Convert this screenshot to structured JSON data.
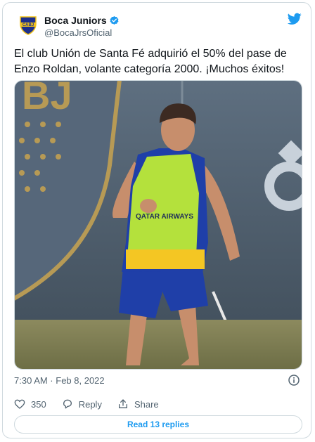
{
  "author": {
    "display_name": "Boca Juniors",
    "handle": "@BocaJrsOficial",
    "avatar_text": "CABJ",
    "verified_icon": "verified-badge-icon"
  },
  "tweet": {
    "text": "El club Unión de Santa Fé adquirió el 50% del pase de Enzo Roldan, volante categoría 2000. ¡Muchos éxitos!",
    "timestamp": "7:30 AM · Feb 8, 2022",
    "media": {
      "description_icon": "photo",
      "kit_text": "QATAR AIRWAYS"
    }
  },
  "actions": {
    "like_count": "350",
    "reply_label": "Reply",
    "share_label": "Share",
    "read_replies_label": "Read 13 replies"
  },
  "colors": {
    "accent": "#1d9bf0",
    "text_secondary": "#536471",
    "border": "#cfd9de",
    "boca_blue": "#1c2f8c",
    "boca_gold": "#f2c31a"
  }
}
